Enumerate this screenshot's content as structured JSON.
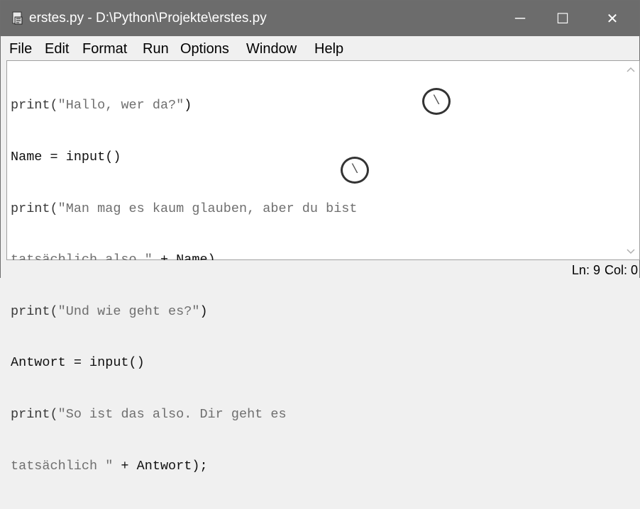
{
  "window": {
    "title": "erstes.py - D:\\Python\\Projekte\\erstes.py"
  },
  "titlebar_buttons": {
    "minimize": "─",
    "maximize": "☐",
    "close": "✕"
  },
  "menu": [
    {
      "label": "File"
    },
    {
      "label": "Edit"
    },
    {
      "label": "Format"
    },
    {
      "label": "Run"
    },
    {
      "label": "Options"
    },
    {
      "label": "Window"
    },
    {
      "label": "Help"
    }
  ],
  "code": [
    {
      "kw": "print(",
      "str": "\"Hallo, wer da?\"",
      "rest": ")"
    },
    {
      "kw": "",
      "str": "",
      "rest": "Name = input()"
    },
    {
      "kw": "print(",
      "str": "\"Man mag es kaum glauben, aber du bist ",
      "rest": ""
    },
    {
      "kw": "",
      "str": "tatsächlich also \"",
      "rest": " + Name)"
    },
    {
      "kw": "print(",
      "str": "\"Und wie geht es?\"",
      "rest": ")"
    },
    {
      "kw": "",
      "str": "",
      "rest": "Antwort = input()"
    },
    {
      "kw": "print(",
      "str": "\"So ist das also. Dir geht es ",
      "rest": ""
    },
    {
      "kw": "",
      "str": "tatsächlich \"",
      "rest": " + Antwort);"
    }
  ],
  "markers": [
    {
      "symbol": "\\"
    },
    {
      "symbol": "\\"
    }
  ],
  "status": {
    "line": "Ln: 9",
    "col": "Col: 0"
  },
  "icons": {
    "app": "python-file-icon",
    "scroll_up": "chevron-up-icon",
    "scroll_down": "chevron-down-icon"
  }
}
